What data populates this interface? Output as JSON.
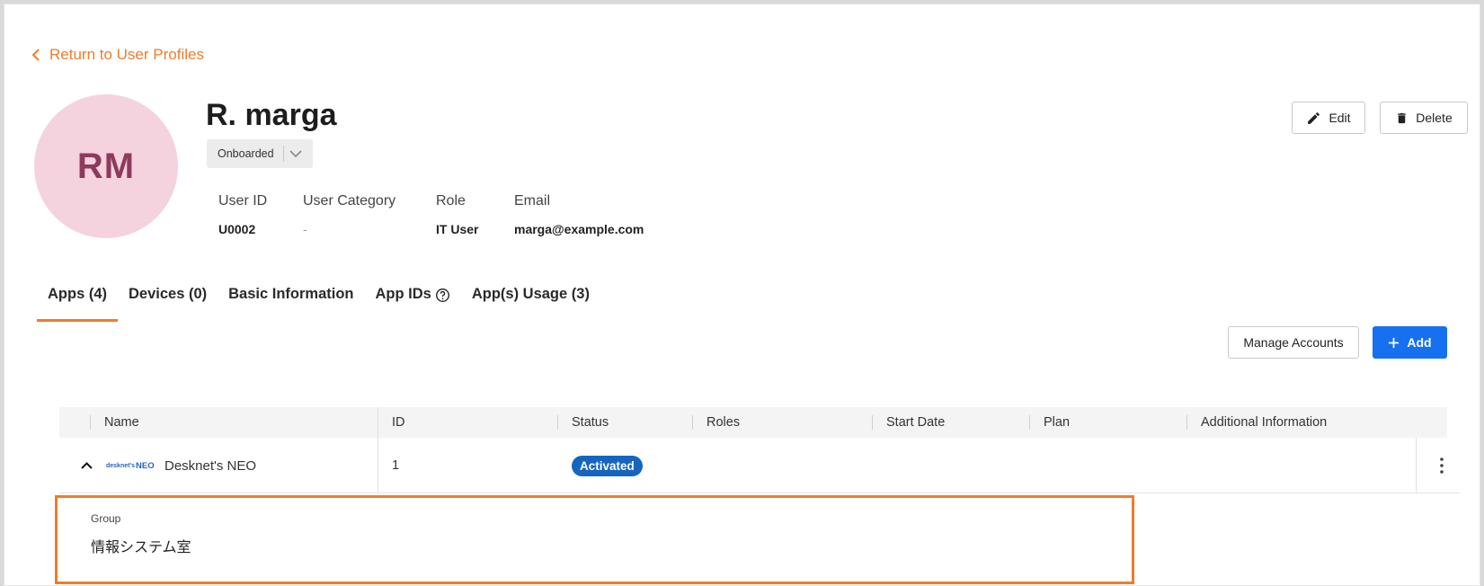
{
  "nav": {
    "back_label": "Return to User Profiles"
  },
  "profile": {
    "initials": "RM",
    "name": "R. marga",
    "status": "Onboarded",
    "fields": [
      {
        "label": "User ID",
        "value": "U0002"
      },
      {
        "label": "User Category",
        "value": "-"
      },
      {
        "label": "Role",
        "value": "IT User"
      },
      {
        "label": "Email",
        "value": "marga@example.com"
      }
    ]
  },
  "actions": {
    "edit_label": "Edit",
    "delete_label": "Delete"
  },
  "tabs": [
    {
      "label": "Apps (4)",
      "active": true
    },
    {
      "label": "Devices (0)",
      "active": false
    },
    {
      "label": "Basic Information",
      "active": false
    },
    {
      "label": "App IDs",
      "active": false,
      "help_icon": "question-circle-icon"
    },
    {
      "label": "App(s) Usage (3)",
      "active": false
    }
  ],
  "toolbar": {
    "manage_label": "Manage Accounts",
    "add_label": "Add"
  },
  "table": {
    "columns": [
      "Name",
      "ID",
      "Status",
      "Roles",
      "Start Date",
      "Plan",
      "Additional Information"
    ],
    "rows": [
      {
        "logo_text_small": "desknet's",
        "logo_text_big": "NEO",
        "name": "Desknet's NEO",
        "id": "1",
        "status": "Activated",
        "roles": "",
        "start_date": "",
        "plan": "",
        "additional_information": ""
      }
    ]
  },
  "expanded": {
    "group_label": "Group",
    "group_value": "情報システム室"
  },
  "colors": {
    "accent": "#f07c2a",
    "primary": "#1670f0",
    "badge": "#1565c0",
    "avatar_bg": "#f4d3de",
    "avatar_text": "#8e3a5c"
  }
}
